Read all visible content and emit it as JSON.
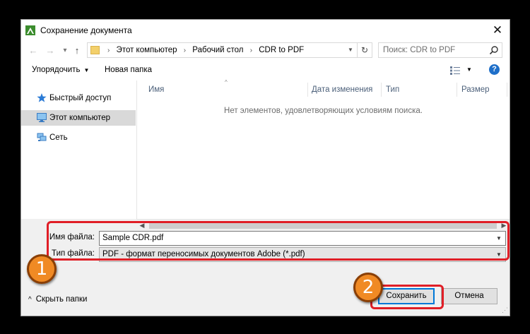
{
  "window": {
    "title": "Сохранение документа"
  },
  "address": {
    "crumbs": [
      "Этот компьютер",
      "Рабочий стол",
      "CDR to PDF"
    ]
  },
  "search": {
    "placeholder": "Поиск: CDR to PDF"
  },
  "toolbar": {
    "organize": "Упорядочить",
    "new_folder": "Новая папка"
  },
  "nav_pane": {
    "items": [
      {
        "label": "Быстрый доступ",
        "icon": "star-icon"
      },
      {
        "label": "Этот компьютер",
        "icon": "computer-icon",
        "selected": true
      },
      {
        "label": "Сеть",
        "icon": "network-icon"
      }
    ]
  },
  "file_list": {
    "columns": [
      "Имя",
      "Дата изменения",
      "Тип",
      "Размер"
    ],
    "empty_message": "Нет элементов, удовлетворяющих условиям поиска."
  },
  "form": {
    "filename_label": "Имя файла:",
    "filename_value": "Sample CDR.pdf",
    "filetype_label": "Тип файла:",
    "filetype_value": "PDF - формат переносимых документов Adobe (*.pdf)"
  },
  "footer": {
    "hide_folders": "Скрыть папки",
    "save": "Сохранить",
    "cancel": "Отмена"
  },
  "annotations": {
    "badge1": "1",
    "badge2": "2",
    "highlight_color": "#e01e26",
    "badge_color": "#f08a24"
  }
}
